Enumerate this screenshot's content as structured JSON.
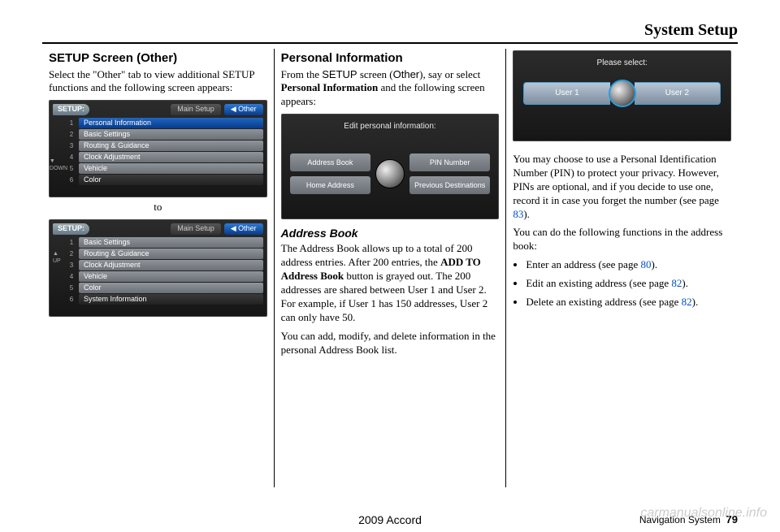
{
  "header": "System Setup",
  "footer": {
    "model": "2009 Accord",
    "label": "Navigation System",
    "page": "79"
  },
  "watermark": "carmanualsonline.info",
  "col1": {
    "h": "SETUP Screen (Other)",
    "p1a": "Select the \"Other\" tab to view additional SETUP functions and the following screen appears:",
    "to": "to",
    "screenA": {
      "label": "SETUP:",
      "mainTab": "Main Setup",
      "otherTab": "Other",
      "nums": [
        "1",
        "2",
        "3",
        "4",
        "5",
        "6"
      ],
      "rows": [
        "Personal Information",
        "Basic Settings",
        "Routing & Guidance",
        "Clock Adjustment",
        "Vehicle",
        "Color"
      ],
      "down": "▼ DOWN"
    },
    "screenB": {
      "label": "SETUP:",
      "mainTab": "Main Setup",
      "otherTab": "Other",
      "nums": [
        "1",
        "2",
        "3",
        "4",
        "5",
        "6"
      ],
      "rows": [
        "Basic Settings",
        "Routing & Guidance",
        "Clock Adjustment",
        "Vehicle",
        "Color",
        "System Information"
      ],
      "up": "▲ UP"
    }
  },
  "col2": {
    "h": "Personal Information",
    "p1": {
      "a": "From the ",
      "b": "SETUP",
      "c": " screen (",
      "d": "Other",
      "e": "), say or select ",
      "f": "Personal Information",
      "g": " and the following screen appears:"
    },
    "editScreen": {
      "title": "Edit personal information:",
      "b1": "Address Book",
      "b2": "PIN Number",
      "b3": "Home Address",
      "b4": "Previous Destinations"
    },
    "sub": "Address Book",
    "p2": {
      "a": "The Address Book allows up to a total of 200 address entries. After 200 entries, the ",
      "b": "ADD TO Address Book",
      "c": " button is grayed out. The 200 addresses are shared between User 1 and User 2. For example, if User 1 has 150 addresses, User 2 can only have 50."
    },
    "p3": "You can add, modify, and delete information in the personal Address Book list."
  },
  "col3": {
    "selectScreen": {
      "title": "Please select:",
      "u1": "User 1",
      "u2": "User 2"
    },
    "p1": {
      "a": "You may choose to use a Personal Identification Number (PIN) to protect your privacy. However, PINs are optional, and if you decide to use one, record it in case you forget the number (see page ",
      "b": "83",
      "c": ")."
    },
    "p2": "You can do the following functions in the address book:",
    "li1": {
      "a": "Enter an address (see page ",
      "b": "80",
      "c": ")."
    },
    "li2": {
      "a": "Edit an existing address (see page ",
      "b": "82",
      "c": ")."
    },
    "li3": {
      "a": "Delete an existing address (see page ",
      "b": "82",
      "c": ")."
    }
  }
}
